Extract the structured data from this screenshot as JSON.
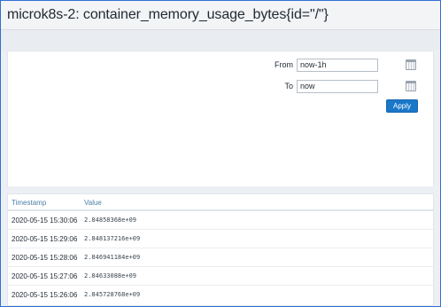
{
  "header": {
    "title": "microk8s-2: container_memory_usage_bytes{id=\"/\"}"
  },
  "filter": {
    "from_label": "From",
    "from_value": "now-1h",
    "to_label": "To",
    "to_value": "now",
    "apply_label": "Apply",
    "calendar_icon": "calendar-icon"
  },
  "table": {
    "columns": [
      "Timestamp",
      "Value"
    ],
    "rows": [
      {
        "timestamp": "2020-05-15 15:30:06",
        "value": "2.84858368e+09"
      },
      {
        "timestamp": "2020-05-15 15:29:06",
        "value": "2.848137216e+09"
      },
      {
        "timestamp": "2020-05-15 15:28:06",
        "value": "2.846941184e+09"
      },
      {
        "timestamp": "2020-05-15 15:27:06",
        "value": "2.84633088e+09"
      },
      {
        "timestamp": "2020-05-15 15:26:06",
        "value": "2.845728768e+09"
      }
    ]
  },
  "colors": {
    "accent": "#1a77c9",
    "frame_border": "#2f6fd4",
    "header_text": "#4a7fa7"
  }
}
